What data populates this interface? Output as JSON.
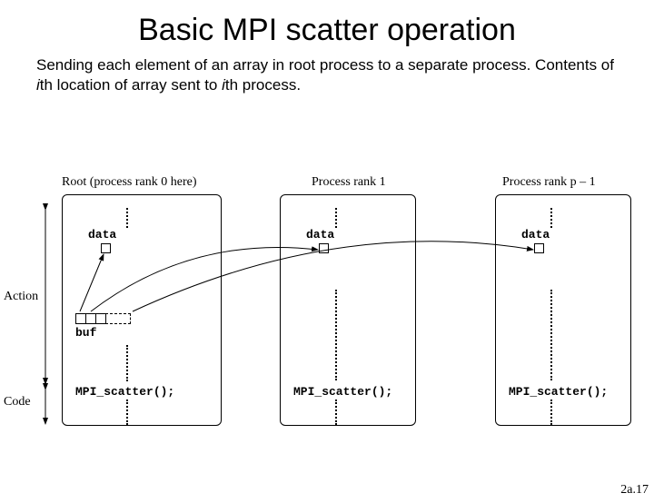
{
  "title": "Basic MPI scatter operation",
  "description_parts": {
    "p1": "Sending each element of an array in root process to a separate process. Contents of ",
    "i1": "i",
    "p2": "th location of array sent to ",
    "i2": "i",
    "p3": "th process."
  },
  "labels": {
    "root": "Root (process rank 0 here)",
    "proc1": "Process rank 1",
    "procN": "Process rank p – 1",
    "data": "data",
    "buf": "buf",
    "scatter": "MPI_scatter();",
    "action": "Action",
    "code": "Code"
  },
  "footer": "2a.17",
  "chart_data": {
    "type": "diagram",
    "title": "Basic MPI scatter operation",
    "processes": [
      {
        "name": "Root (process rank 0 here)",
        "has_data": true,
        "has_buf": true,
        "calls": "MPI_scatter();"
      },
      {
        "name": "Process rank 1",
        "has_data": true,
        "has_buf": false,
        "calls": "MPI_scatter();"
      },
      {
        "name": "Process rank p – 1",
        "has_data": true,
        "has_buf": false,
        "calls": "MPI_scatter();"
      }
    ],
    "arrows": [
      {
        "from": "root.buf[0]",
        "to": "root.data"
      },
      {
        "from": "root.buf[1]",
        "to": "process1.data"
      },
      {
        "from": "root.buf[n-1]",
        "to": "processN.data"
      }
    ],
    "side_axes": [
      "Action",
      "Code"
    ]
  }
}
